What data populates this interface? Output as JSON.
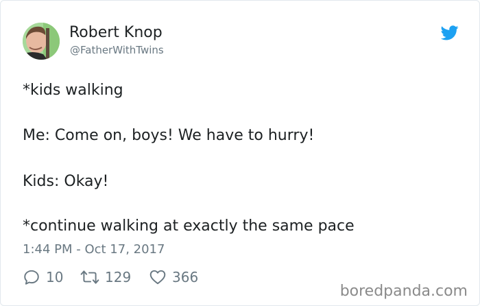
{
  "author": {
    "name": "Robert Knop",
    "handle": "@FatherWithTwins",
    "avatar_icon": "user-photo-avatar"
  },
  "brand_icon": "twitter-bird-icon",
  "tweet": {
    "lines": [
      "*kids walking",
      "Me: Come on, boys! We have to hurry!",
      "Kids: Okay!",
      "*continue walking at exactly the same pace"
    ]
  },
  "timestamp": "1:44 PM - Oct 17, 2017",
  "actions": {
    "reply": {
      "icon": "reply-icon",
      "count": "10"
    },
    "retweet": {
      "icon": "retweet-icon",
      "count": "129"
    },
    "like": {
      "icon": "heart-icon",
      "count": "366"
    }
  },
  "watermark": "boredpanda.com",
  "colors": {
    "twitter_blue": "#1da1f2",
    "text": "#1c2022",
    "muted": "#697882",
    "watermark": "#8a8a8a"
  }
}
